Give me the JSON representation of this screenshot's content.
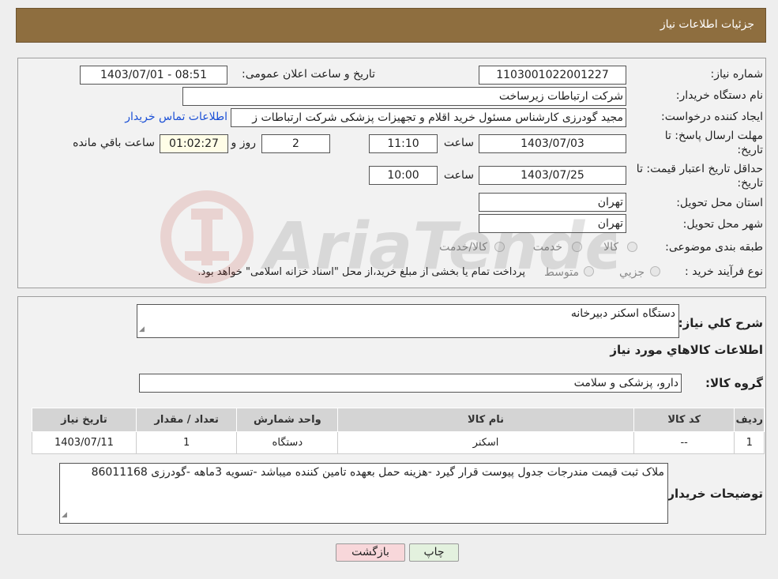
{
  "header": {
    "title": "جزئیات اطلاعات نیاز"
  },
  "form": {
    "need_number": {
      "label": "شماره نیاز:",
      "value": "1103001022001227"
    },
    "announce": {
      "label": "تاریخ و ساعت اعلان عمومی:",
      "value": "1403/07/01 - 08:51"
    },
    "buyer_org": {
      "label": "نام دستگاه خریدار:",
      "value": "شرکت ارتباطات زیرساخت"
    },
    "requester": {
      "label": "ایجاد کننده درخواست:",
      "value": "مجید گودرزی کارشناس مسئول خرید اقلام و تجهیزات پزشکی شرکت ارتباطات ز"
    },
    "contact_link": "اطلاعات تماس خریدار",
    "deadline": {
      "label_line1": "مهلت ارسال پاسخ: تا",
      "label_line2": "تاریخ:",
      "date": "1403/07/03",
      "time_label": "ساعت",
      "time": "11:10",
      "days": "2",
      "days_label": "روز و",
      "remaining": "01:02:27",
      "remaining_label": "ساعت باقي مانده"
    },
    "validity": {
      "label_line1": "حداقل تاریخ اعتبار قیمت: تا",
      "label_line2": "تاریخ:",
      "date": "1403/07/25",
      "time_label": "ساعت",
      "time": "10:00"
    },
    "province": {
      "label": "استان محل تحویل:",
      "value": "تهران"
    },
    "city": {
      "label": "شهر محل تحویل:",
      "value": "تهران"
    },
    "category": {
      "label": "طبقه بندی موضوعی:",
      "options": [
        "کالا",
        "خدمت",
        "کالا/خدمت"
      ]
    },
    "purchase_type": {
      "label": "نوع فرآیند خرید :",
      "options": [
        "جزیي",
        "متوسط"
      ],
      "note": "پرداخت تمام یا بخشی از مبلغ خرید،از محل \"اسناد خزانه اسلامی\" خواهد بود."
    }
  },
  "details": {
    "summary_label": "شرح کلي نياز:",
    "summary_value": "دستگاه اسکنر دبیرخانه",
    "goods_info_title": "اطلاعات كالاهاي مورد نياز",
    "goods_group_label": "گروه کالا:",
    "goods_group_value": "دارو، پزشکی و سلامت",
    "table": {
      "headers": [
        "رديف",
        "كد كالا",
        "نام كالا",
        "واحد شمارش",
        "تعداد / مقدار",
        "تاريخ نياز"
      ],
      "rows": [
        [
          "1",
          "--",
          "اسکنر",
          "دستگاه",
          "1",
          "1403/07/11"
        ]
      ]
    },
    "buyer_notes_label": "توضیحات خریدار:",
    "buyer_notes_value": "ملاک ثبت قیمت مندرجات جدول پیوست قرار گیرد -هزینه حمل بعهده تامین کننده میباشد -تسویه 3ماهه -گودرزی 86011168"
  },
  "buttons": {
    "print": "چاپ",
    "back": "بازگشت"
  },
  "watermark": {
    "text": "AriaTender.neT"
  },
  "colors": {
    "header_bg": "#8e6e3f",
    "link": "#1a4fd6",
    "back_button_bg": "#f8d7da",
    "print_button_bg": "#e3f1de",
    "watermark": "#c0392b"
  }
}
